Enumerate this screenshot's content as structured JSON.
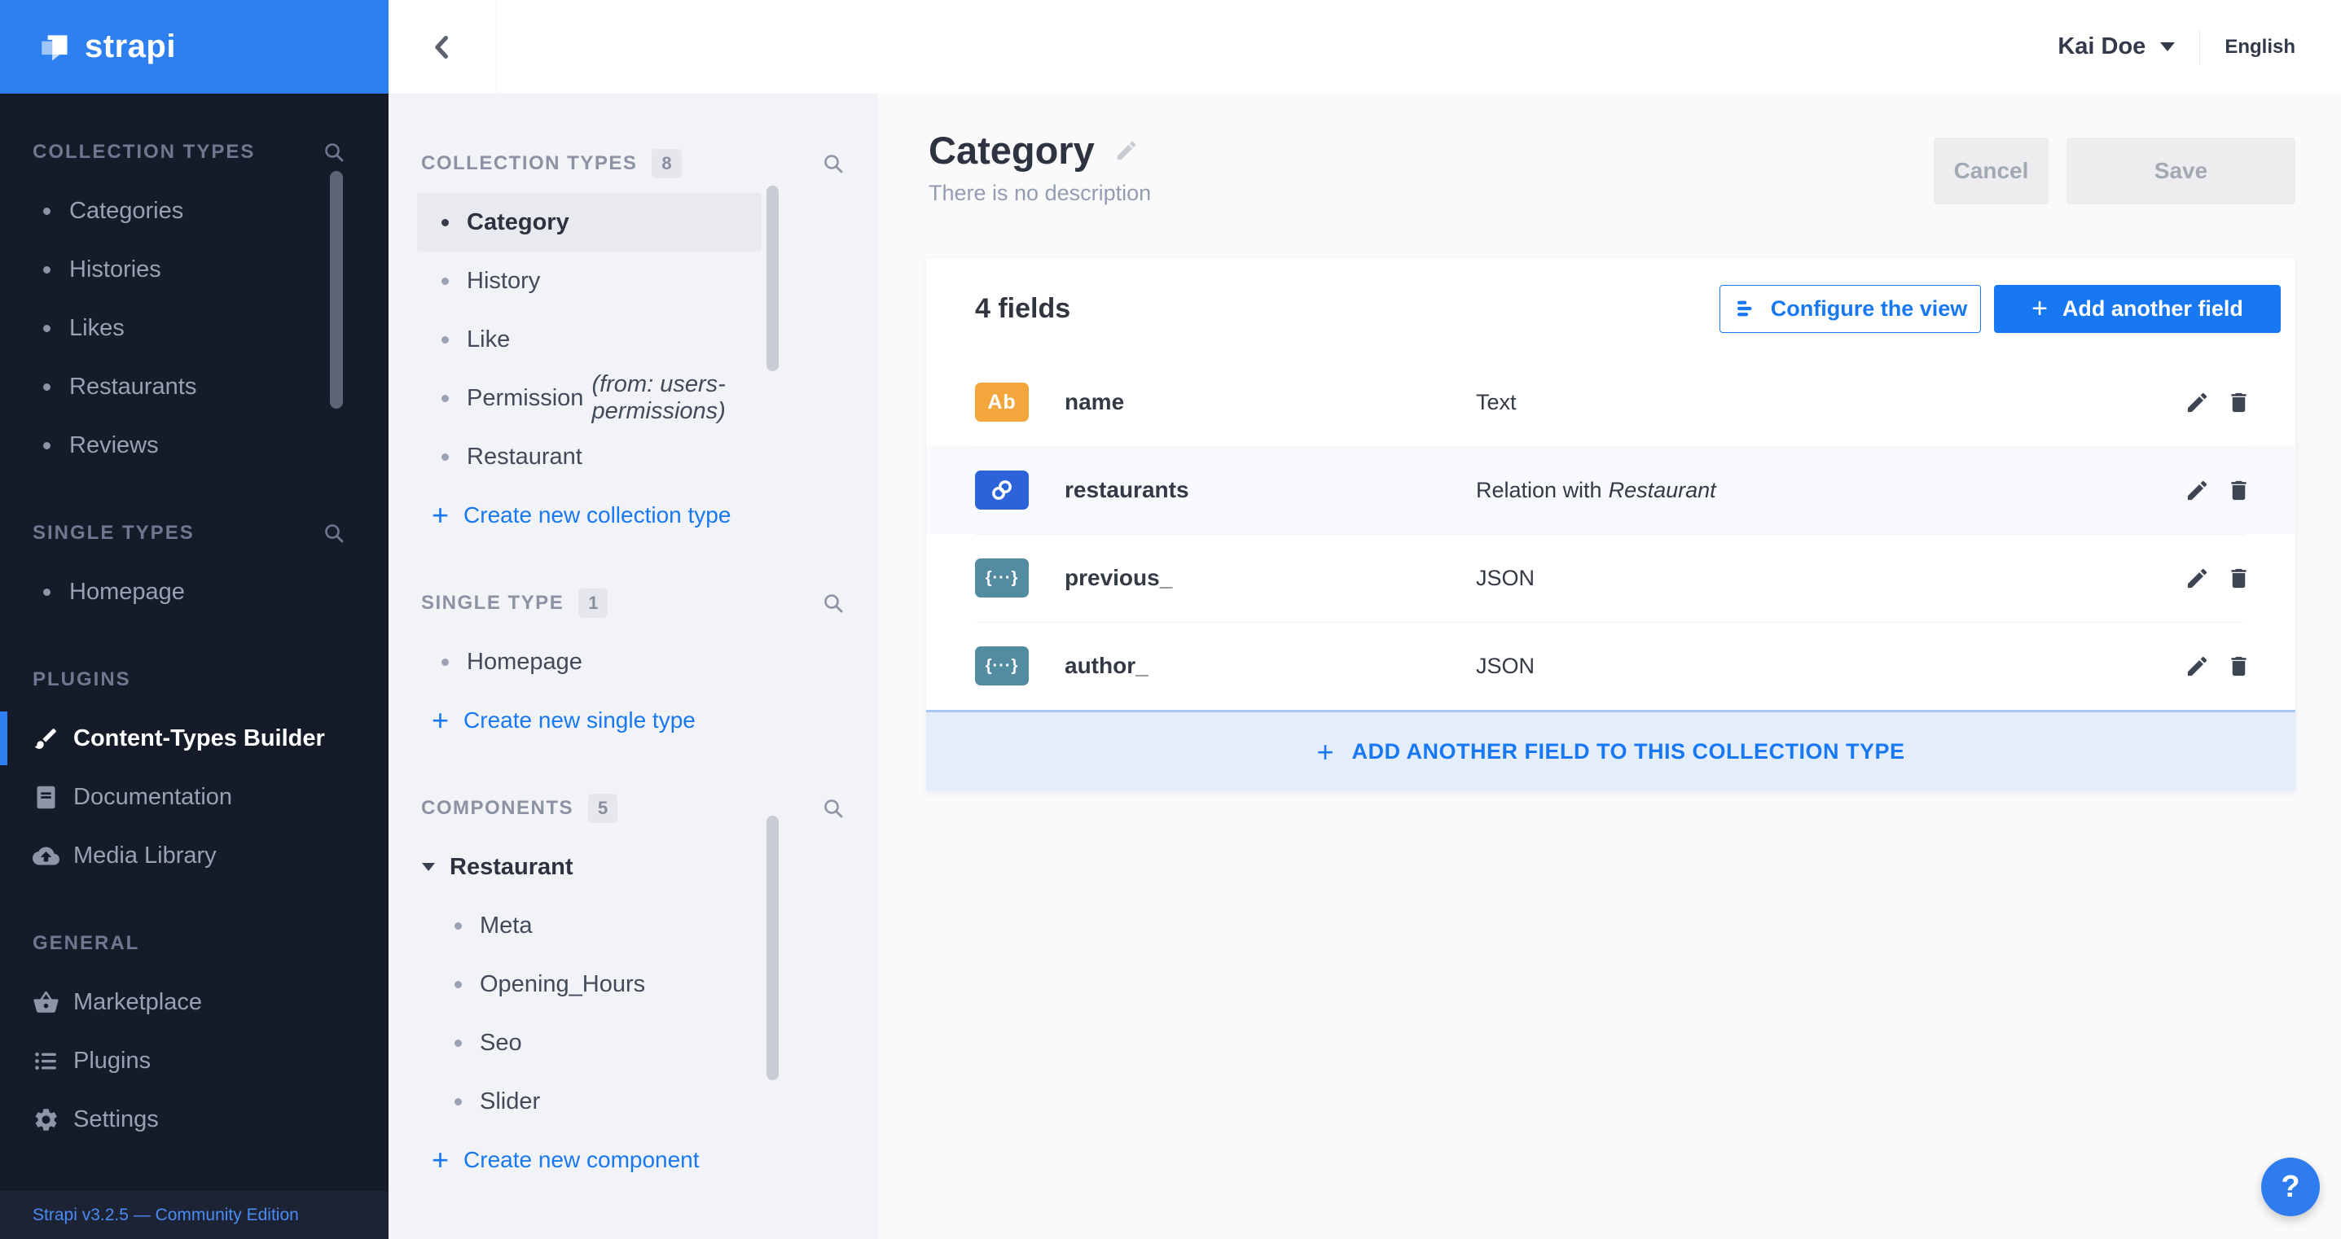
{
  "colors": {
    "brand": "#2e80f0",
    "accent": "#1778f2",
    "badge_text_bg": "#f2a63c",
    "badge_relation_bg": "#2c63d9",
    "badge_json_bg": "#538ca0"
  },
  "icons": {
    "plus": "+"
  },
  "topbar": {
    "user_name": "Kai Doe",
    "language": "English"
  },
  "main_sidebar": {
    "footer": "Strapi v3.2.5 — Community Edition",
    "brand_name": "strapi",
    "sections": [
      {
        "label": "COLLECTION TYPES",
        "items": [
          {
            "label": "Categories"
          },
          {
            "label": "Histories"
          },
          {
            "label": "Likes"
          },
          {
            "label": "Restaurants"
          },
          {
            "label": "Reviews"
          }
        ]
      },
      {
        "label": "SINGLE TYPES",
        "items": [
          {
            "label": "Homepage"
          }
        ]
      },
      {
        "label": "PLUGINS",
        "items": [
          {
            "label": "Content-Types Builder"
          },
          {
            "label": "Documentation"
          },
          {
            "label": "Media Library"
          }
        ]
      },
      {
        "label": "GENERAL",
        "items": [
          {
            "label": "Marketplace"
          },
          {
            "label": "Plugins"
          },
          {
            "label": "Settings"
          }
        ]
      }
    ]
  },
  "sub_sidebar": {
    "groups": [
      {
        "title": "COLLECTION TYPES",
        "count": "8",
        "action": "Create new collection type",
        "items": [
          {
            "label": "Category"
          },
          {
            "label": "History"
          },
          {
            "label": "Like"
          },
          {
            "label": "Permission",
            "suffix": "(from: users-permissions)"
          },
          {
            "label": "Restaurant"
          }
        ]
      },
      {
        "title": "SINGLE TYPE",
        "count": "1",
        "action": "Create new single type",
        "items": [
          {
            "label": "Homepage"
          }
        ]
      },
      {
        "title": "COMPONENTS",
        "count": "5",
        "action": "Create new component",
        "items": [
          {
            "label": "Restaurant"
          },
          {
            "label": "Meta"
          },
          {
            "label": "Opening_Hours"
          },
          {
            "label": "Seo"
          },
          {
            "label": "Slider"
          }
        ]
      }
    ]
  },
  "content": {
    "title": "Category",
    "subtitle": "There is no description",
    "cancel_label": "Cancel",
    "save_label": "Save",
    "fields_count_label": "4 fields",
    "configure_view_label": "Configure the view",
    "add_field_label": "Add another field",
    "add_band_label": "ADD ANOTHER FIELD TO THIS COLLECTION TYPE",
    "rows": [
      {
        "badge_label": "Ab",
        "name": "name",
        "type": "Text"
      },
      {
        "name": "restaurants",
        "type": "Relation with",
        "type_target": "Restaurant"
      },
      {
        "badge_label": "{···}",
        "name": "previous_",
        "type": "JSON"
      },
      {
        "badge_label": "{···}",
        "name": "author_",
        "type": "JSON"
      }
    ]
  },
  "help": {
    "label": "?"
  }
}
